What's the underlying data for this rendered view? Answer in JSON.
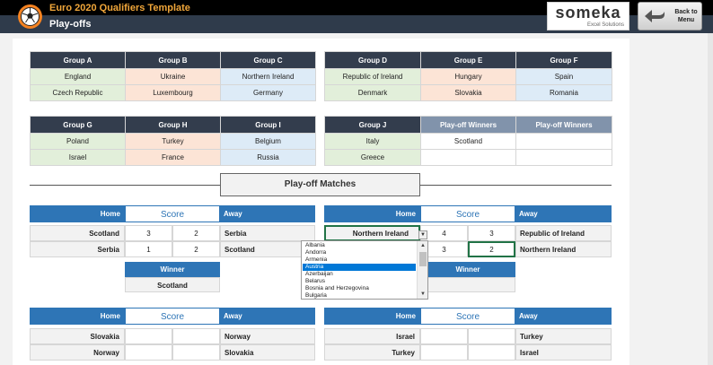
{
  "header": {
    "app_title": "Euro 2020 Qualifiers Template",
    "page_title": "Play-offs",
    "logo_brand": "someka",
    "logo_sub": "Excel Solutions",
    "back_label": "Back to\nMenu"
  },
  "colors": {
    "header_dark": "#2f3b4b",
    "group_header": "#333d4d",
    "match_header": "#2e75b6",
    "accent_orange": "#f58220"
  },
  "groups_row1_left": {
    "headers": [
      "Group A",
      "Group B",
      "Group C"
    ],
    "rows": [
      [
        "England",
        "Ukraine",
        "Northern Ireland"
      ],
      [
        "Czech Republic",
        "Luxembourg",
        "Germany"
      ]
    ]
  },
  "groups_row1_right": {
    "headers": [
      "Group D",
      "Group E",
      "Group F"
    ],
    "rows": [
      [
        "Republic of Ireland",
        "Hungary",
        "Spain"
      ],
      [
        "Denmark",
        "Slovakia",
        "Romania"
      ]
    ]
  },
  "groups_row2_left": {
    "headers": [
      "Group G",
      "Group H",
      "Group I"
    ],
    "rows": [
      [
        "Poland",
        "Turkey",
        "Belgium"
      ],
      [
        "Israel",
        "France",
        "Russia"
      ]
    ]
  },
  "groups_row2_right": {
    "headers": [
      "Group J",
      "Play-off Winners",
      "Play-off Winners"
    ],
    "rows": [
      [
        "Italy",
        "Scotland",
        ""
      ],
      [
        "Greece",
        "",
        ""
      ]
    ]
  },
  "playoff_title": "Play-off Matches",
  "labels": {
    "home": "Home",
    "score": "Score",
    "away": "Away",
    "winner": "Winner"
  },
  "match1": {
    "lines": [
      {
        "home": "Scotland",
        "s1": "3",
        "s2": "2",
        "away": "Serbia"
      },
      {
        "home": "Serbia",
        "s1": "1",
        "s2": "2",
        "away": "Scotland"
      }
    ],
    "winner": "Scotland"
  },
  "match2": {
    "lines": [
      {
        "home": "Northern Ireland",
        "s1": "4",
        "s2": "3",
        "away": "Republic of Ireland"
      },
      {
        "home": "",
        "s1": "3",
        "s2": "2",
        "away": "Northern Ireland"
      }
    ],
    "winner": ""
  },
  "match3": {
    "lines": [
      {
        "home": "Slovakia",
        "s1": "",
        "s2": "",
        "away": "Norway"
      },
      {
        "home": "Norway",
        "s1": "",
        "s2": "",
        "away": "Slovakia"
      }
    ]
  },
  "match4": {
    "lines": [
      {
        "home": "Israel",
        "s1": "",
        "s2": "",
        "away": "Turkey"
      },
      {
        "home": "Turkey",
        "s1": "",
        "s2": "",
        "away": "Israel"
      }
    ]
  },
  "dropdown": {
    "items": [
      "Albania",
      "Andorra",
      "Armenia",
      "Austria",
      "Azerbaijan",
      "Belarus",
      "Bosnia and Herzegovina",
      "Bulgaria"
    ],
    "selected": "Austria"
  }
}
